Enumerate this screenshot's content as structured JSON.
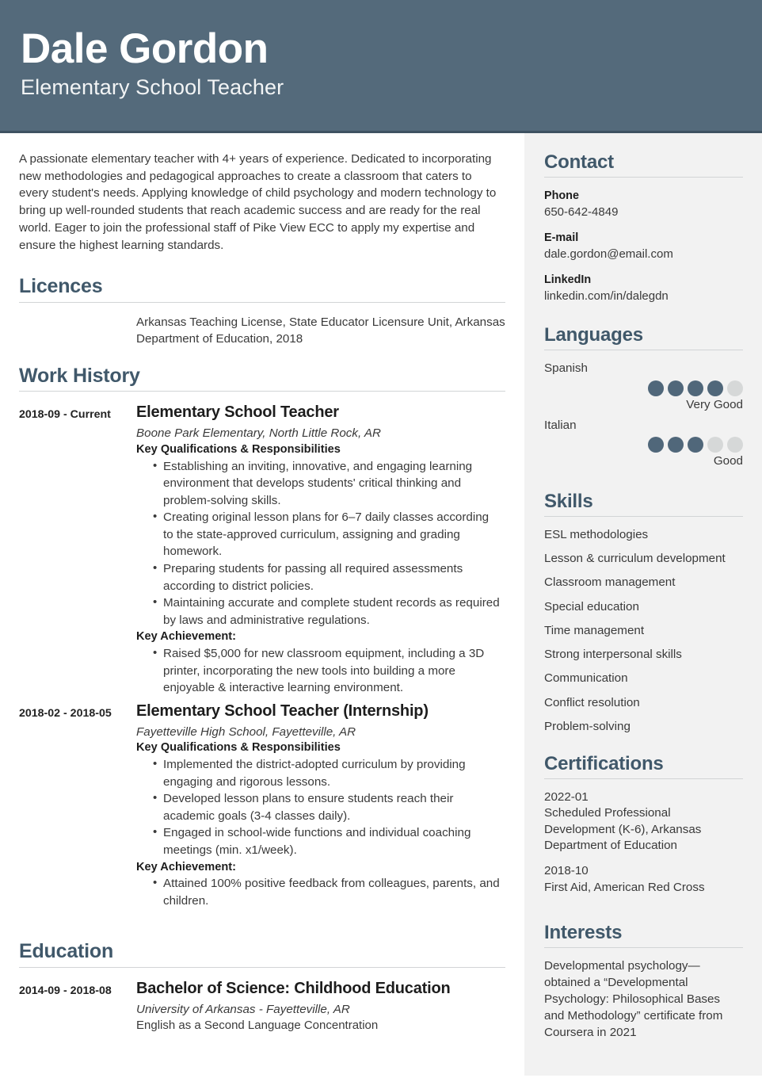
{
  "theme": {
    "banner_bg": "#546A7B",
    "banner_border": "#3E5261",
    "heading_color": "#40586A",
    "sidebar_bg": "#F2F2F2",
    "dot_filled": "#50677A",
    "dot_empty": "#D6D8D8",
    "rule_color": "#D2D4D6"
  },
  "header": {
    "name": "Dale Gordon",
    "title": "Elementary School Teacher"
  },
  "summary": {
    "text": "A passionate elementary teacher with 4+ years of experience. Dedicated to incorporating new methodologies and pedagogical approaches to create a classroom that caters to every student's needs. Applying knowledge of child psychology and modern technology to bring up well-rounded students that reach academic success and are ready for the real world. Eager to join the professional staff of Pike View ECC to apply my expertise and ensure the highest learning standards."
  },
  "licences": {
    "heading": "Licences",
    "text": "Arkansas Teaching License, State Educator Licensure Unit, Arkansas Department of Education, 2018"
  },
  "work_history": {
    "heading": "Work History",
    "entries": [
      {
        "dates": "2018-09 - Current",
        "title": "Elementary School Teacher",
        "org": "Boone Park Elementary, North Little Rock, AR",
        "qual_label": "Key Qualifications & Responsibilities",
        "quals": [
          "Establishing an inviting, innovative, and engaging learning environment that develops students' critical thinking and problem-solving skills.",
          "Creating original lesson plans for 6–7 daily classes according to the state-approved curriculum, assigning and grading homework.",
          "Preparing students for passing all required assessments according to district policies.",
          "Maintaining accurate and complete student records as required by laws and administrative regulations."
        ],
        "ach_label": "Key Achievement:",
        "achievements": [
          "Raised $5,000 for new classroom equipment, including a 3D printer, incorporating the new tools into building a more enjoyable & interactive learning environment."
        ]
      },
      {
        "dates": "2018-02 - 2018-05",
        "title": "Elementary School Teacher (Internship)",
        "org": "Fayetteville High School, Fayetteville, AR",
        "qual_label": "Key Qualifications & Responsibilities",
        "quals": [
          "Implemented the district-adopted curriculum by providing engaging and rigorous lessons.",
          "Developed lesson plans to ensure students reach their academic goals (3-4 classes daily).",
          "Engaged in school-wide functions and individual coaching meetings (min. x1/week)."
        ],
        "ach_label": "Key Achievement:",
        "achievements": [
          "Attained 100% positive feedback from colleagues, parents, and children."
        ]
      }
    ]
  },
  "education": {
    "heading": "Education",
    "entries": [
      {
        "dates": "2014-09 - 2018-08",
        "title": "Bachelor of Science: Childhood Education",
        "org": "University of Arkansas - Fayetteville, AR",
        "extra": "English as a Second Language Concentration"
      }
    ]
  },
  "contact": {
    "heading": "Contact",
    "items": [
      {
        "label": "Phone",
        "value": "650-642-4849"
      },
      {
        "label": "E-mail",
        "value": "dale.gordon@email.com"
      },
      {
        "label": "LinkedIn",
        "value": "linkedin.com/in/dalegdn"
      }
    ]
  },
  "languages": {
    "heading": "Languages",
    "items": [
      {
        "name": "Spanish",
        "level": "Very Good",
        "filled": 4,
        "total": 5
      },
      {
        "name": "Italian",
        "level": "Good",
        "filled": 3,
        "total": 5
      }
    ]
  },
  "skills": {
    "heading": "Skills",
    "items": [
      "ESL methodologies",
      "Lesson & curriculum development",
      "Classroom management",
      "Special education",
      "Time management",
      "Strong interpersonal skills",
      "Communication",
      "Conflict resolution",
      "Problem-solving"
    ]
  },
  "certifications": {
    "heading": "Certifications",
    "items": [
      {
        "date": "2022-01",
        "text": "Scheduled Professional Development (K-6), Arkansas Department of Education"
      },
      {
        "date": "2018-10",
        "text": "First Aid, American Red Cross"
      }
    ]
  },
  "interests": {
    "heading": "Interests",
    "text": "Developmental psychology—obtained a “Developmental Psychology: Philosophical Bases and Methodology” certificate from Coursera in 2021"
  }
}
